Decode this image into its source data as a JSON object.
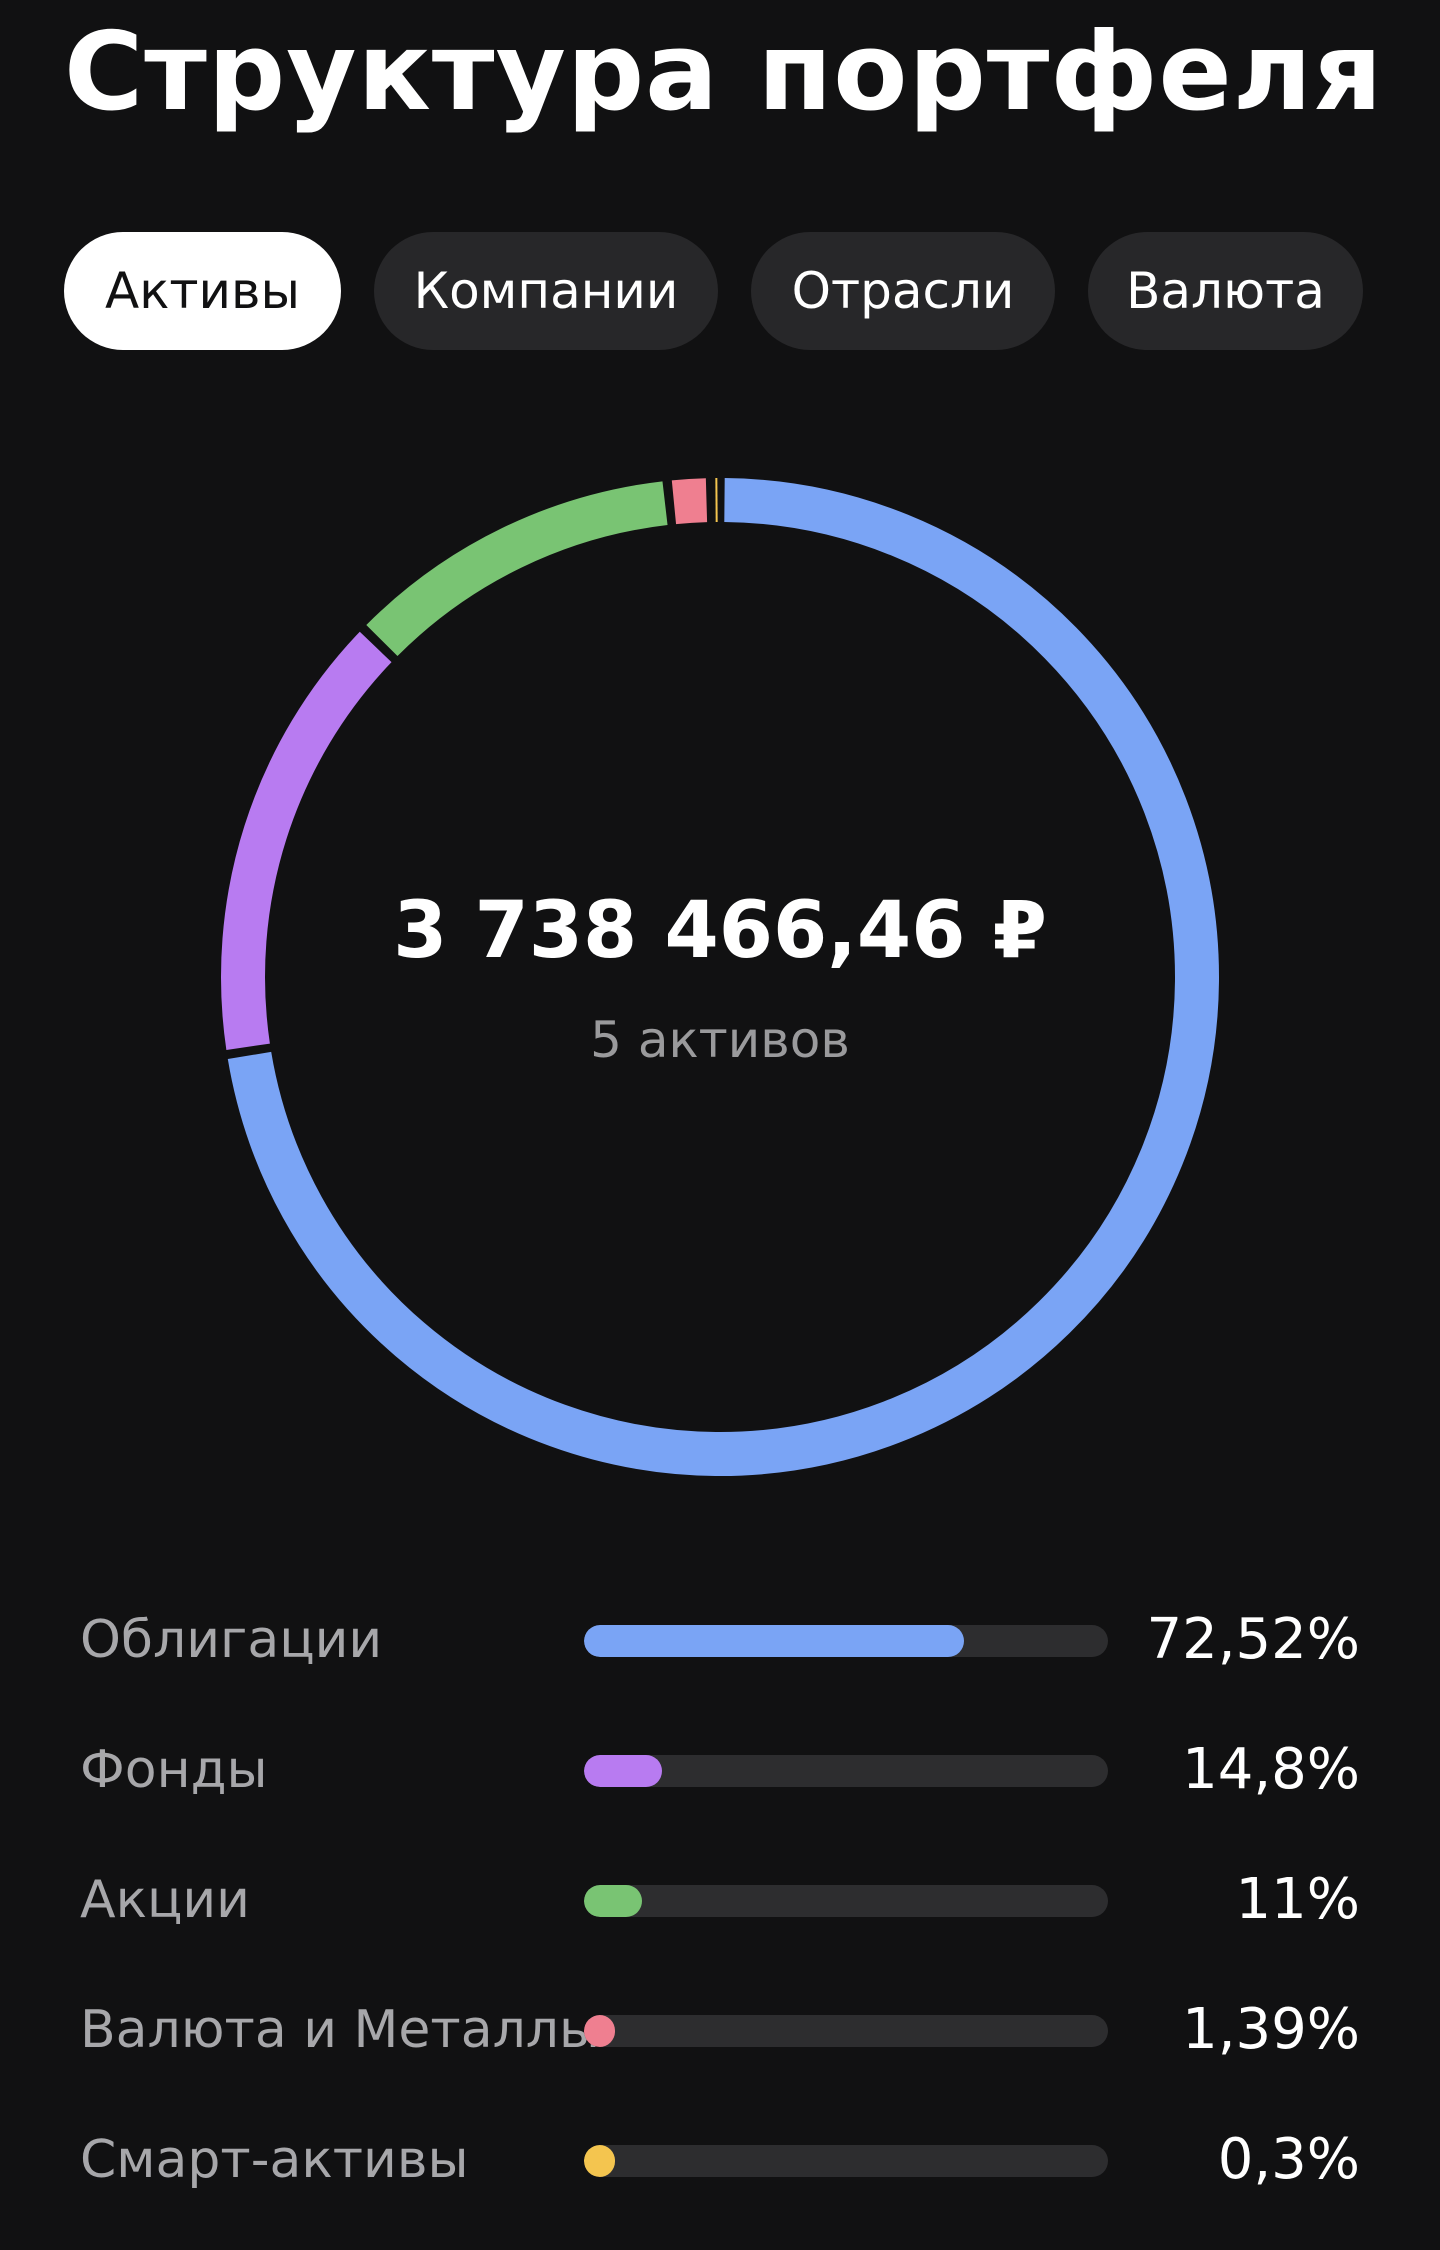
{
  "page": {
    "title": "Структура портфеля"
  },
  "tabs": [
    {
      "label": "Активы",
      "active": true
    },
    {
      "label": "Компании",
      "active": false
    },
    {
      "label": "Отрасли",
      "active": false
    },
    {
      "label": "Валюта",
      "active": false
    }
  ],
  "summary": {
    "total": "3 738 466,46 ₽",
    "count_label": "5 активов"
  },
  "chart_data": {
    "type": "pie",
    "style": "donut",
    "categories": [
      "Облигации",
      "Фонды",
      "Акции",
      "Валюта и Металлы",
      "Смарт-активы"
    ],
    "values": [
      72.52,
      14.8,
      11,
      1.39,
      0.3
    ],
    "value_labels": [
      "72,52%",
      "14,8%",
      "11%",
      "1,39%",
      "0,3%"
    ],
    "colors": [
      "#7aa4f5",
      "#b87bf1",
      "#79c473",
      "#ef7f90",
      "#f4c54f"
    ]
  }
}
